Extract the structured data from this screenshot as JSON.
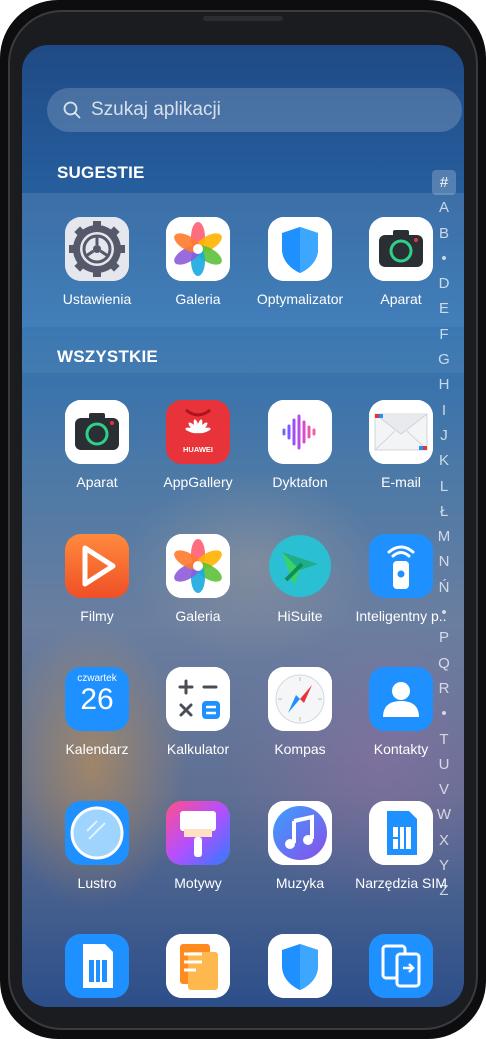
{
  "search": {
    "placeholder": "Szukaj aplikacji"
  },
  "sections": {
    "suggestions_title": "SUGESTIE",
    "all_title": "WSZYSTKIE"
  },
  "suggestions": [
    {
      "label": "Ustawienia",
      "icon": "settings-icon"
    },
    {
      "label": "Galeria",
      "icon": "gallery-icon"
    },
    {
      "label": "Optymalizator",
      "icon": "optimizer-shield-icon"
    },
    {
      "label": "Aparat",
      "icon": "camera-icon"
    }
  ],
  "apps": [
    {
      "label": "Aparat",
      "icon": "camera-icon"
    },
    {
      "label": "AppGallery",
      "icon": "appgallery-icon",
      "brand_text": "HUAWEI"
    },
    {
      "label": "Dyktafon",
      "icon": "recorder-icon"
    },
    {
      "label": "E-mail",
      "icon": "email-icon"
    },
    {
      "label": "Filmy",
      "icon": "video-play-icon"
    },
    {
      "label": "Galeria",
      "icon": "gallery-icon"
    },
    {
      "label": "HiSuite",
      "icon": "hisuite-icon"
    },
    {
      "label": "Inteligentny p..",
      "icon": "smart-remote-icon"
    },
    {
      "label": "Kalendarz",
      "icon": "calendar-icon",
      "calendar_day": "czwartek",
      "calendar_date": "26"
    },
    {
      "label": "Kalkulator",
      "icon": "calculator-icon"
    },
    {
      "label": "Kompas",
      "icon": "compass-icon"
    },
    {
      "label": "Kontakty",
      "icon": "contacts-icon"
    },
    {
      "label": "Lustro",
      "icon": "mirror-icon"
    },
    {
      "label": "Motywy",
      "icon": "themes-brush-icon"
    },
    {
      "label": "Muzyka",
      "icon": "music-icon"
    },
    {
      "label": "Narzędzia SIM",
      "icon": "sim-card-icon"
    },
    {
      "label": "",
      "icon": "sim-card-icon"
    },
    {
      "label": "",
      "icon": "files-icon"
    },
    {
      "label": "",
      "icon": "shield-icon"
    },
    {
      "label": "",
      "icon": "phone-clone-icon"
    }
  ],
  "alphabet_index": [
    "#",
    "A",
    "B",
    "•",
    "D",
    "E",
    "F",
    "G",
    "H",
    "I",
    "J",
    "K",
    "L",
    "Ł",
    "M",
    "N",
    "Ń",
    "•",
    "P",
    "Q",
    "R",
    "•",
    "T",
    "U",
    "V",
    "W",
    "X",
    "Y",
    "Z"
  ],
  "colors": {
    "accent_blue": "#1e90ff",
    "appgallery_red": "#e8333a",
    "filmy_orange": "#f26a2a"
  }
}
